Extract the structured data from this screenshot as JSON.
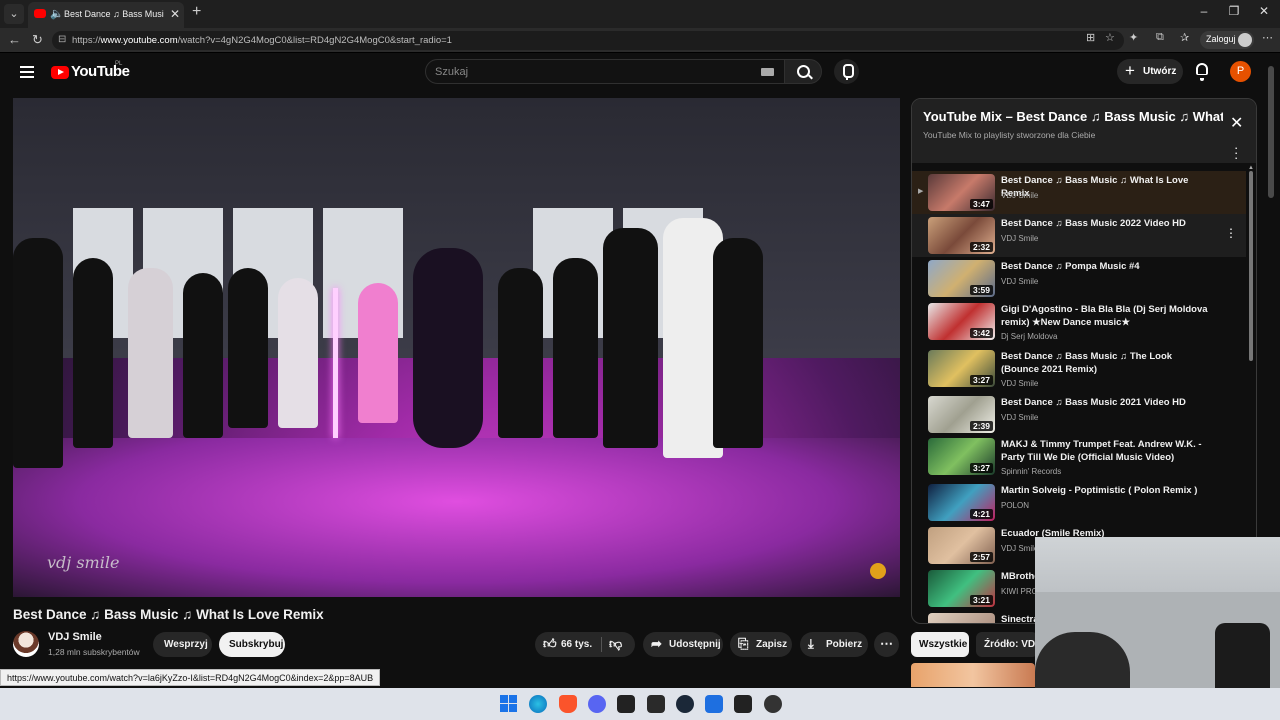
{
  "browser": {
    "tab_title": "Best Dance ♫ Bass Music ♫ W",
    "url_prefix": "https://",
    "url_domain": "www.youtube.com",
    "url_rest": "/watch?v=4gN2G4MogC0&list=RD4gN2G4MogC0&start_radio=1",
    "login_label": "Zaloguj"
  },
  "youtube": {
    "logo_text": "YouTube",
    "logo_country": "PL",
    "search_placeholder": "Szukaj",
    "create_label": "Utwórz",
    "avatar_letter": "P"
  },
  "video": {
    "watermark": "vdj smile",
    "title": "Best Dance ♫ Bass Music ♫ What Is Love Remix",
    "channel_name": "VDJ Smile",
    "channel_subs": "1,28 mln subskrybentów",
    "support_label": "Wesprzyj",
    "subscribe_label": "Subskrybuj",
    "like_count": "66 tys.",
    "share_label": "Udostępnij",
    "save_label": "Zapisz",
    "download_label": "Pobierz"
  },
  "playlist": {
    "title": "YouTube Mix – Best Dance ♫ Bass Music ♫ What Is Love Remix",
    "subtitle": "YouTube Mix to playlisty stworzone dla Ciebie",
    "items": [
      {
        "title": "Best Dance ♫ Bass Music ♫ What Is Love Remix",
        "channel": "VDJ Smile",
        "duration": "3:47"
      },
      {
        "title": "Best Dance ♫ Bass Music 2022 Video HD",
        "channel": "VDJ Smile",
        "duration": "2:32"
      },
      {
        "title": "Best Dance ♫ Pompa Music #4",
        "channel": "VDJ Smile",
        "duration": "3:59"
      },
      {
        "title": "Gigi D'Agostino - Bla Bla Bla (Dj Serj Moldova remix) ★New Dance music★",
        "channel": "Dj Serj Moldova",
        "duration": "3:42"
      },
      {
        "title": "Best Dance ♫ Bass Music ♫ The Look (Bounce 2021 Remix)",
        "channel": "VDJ Smile",
        "duration": "3:27"
      },
      {
        "title": "Best Dance ♫ Bass Music 2021 Video HD",
        "channel": "VDJ Smile",
        "duration": "2:39"
      },
      {
        "title": "MAKJ & Timmy Trumpet Feat. Andrew W.K. - Party Till We Die (Official Music Video)",
        "channel": "Spinnin' Records",
        "duration": "3:27"
      },
      {
        "title": "Martin Solveig - Poptimistic ( Polon Remix )",
        "channel": "POLON",
        "duration": "4:21"
      },
      {
        "title": "Ecuador (Smile Remix)",
        "channel": "VDJ Smile",
        "duration": "2:57"
      },
      {
        "title": "MBrothe",
        "channel": "KIWI PRO",
        "duration": "3:21"
      },
      {
        "title": "Sinectra",
        "channel": "",
        "duration": ""
      }
    ]
  },
  "chips": {
    "all": "Wszystkie",
    "source": "Źródło: VDJ"
  },
  "status_url": "https://www.youtube.com/watch?v=la6jKyZzo-I&list=RD4gN2G4MogC0&index=2&pp=8AUB"
}
